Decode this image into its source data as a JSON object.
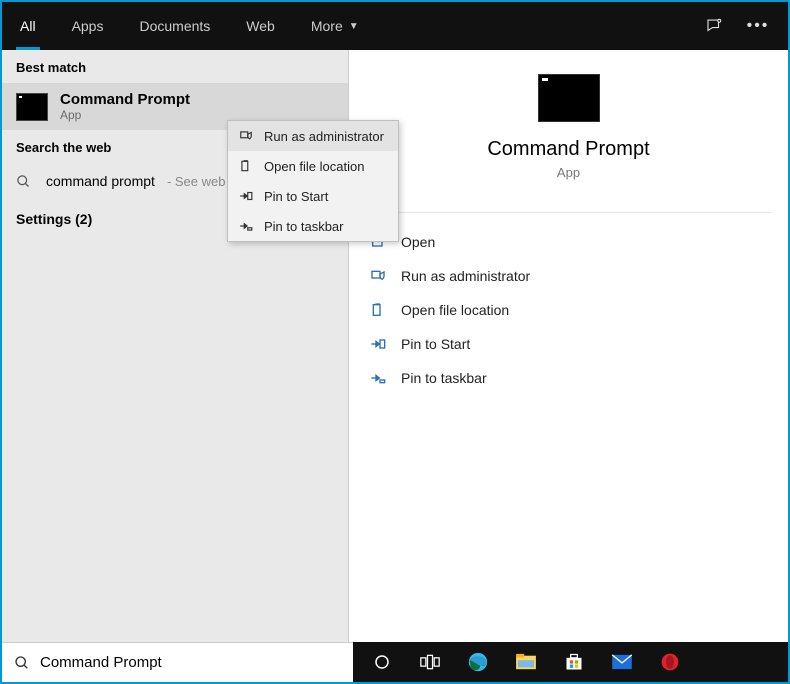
{
  "header": {
    "tabs": [
      "All",
      "Apps",
      "Documents",
      "Web",
      "More"
    ]
  },
  "left": {
    "best_match_label": "Best match",
    "result": {
      "title": "Command Prompt",
      "subtitle": "App"
    },
    "search_web_label": "Search the web",
    "web_query": "command prompt",
    "web_hint": " - See web",
    "settings_label": "Settings (2)"
  },
  "context_menu": {
    "items": [
      "Run as administrator",
      "Open file location",
      "Pin to Start",
      "Pin to taskbar"
    ]
  },
  "detail": {
    "title": "Command Prompt",
    "subtitle": "App",
    "actions": [
      "Open",
      "Run as administrator",
      "Open file location",
      "Pin to Start",
      "Pin to taskbar"
    ]
  },
  "search": {
    "value": "Command Prompt"
  }
}
